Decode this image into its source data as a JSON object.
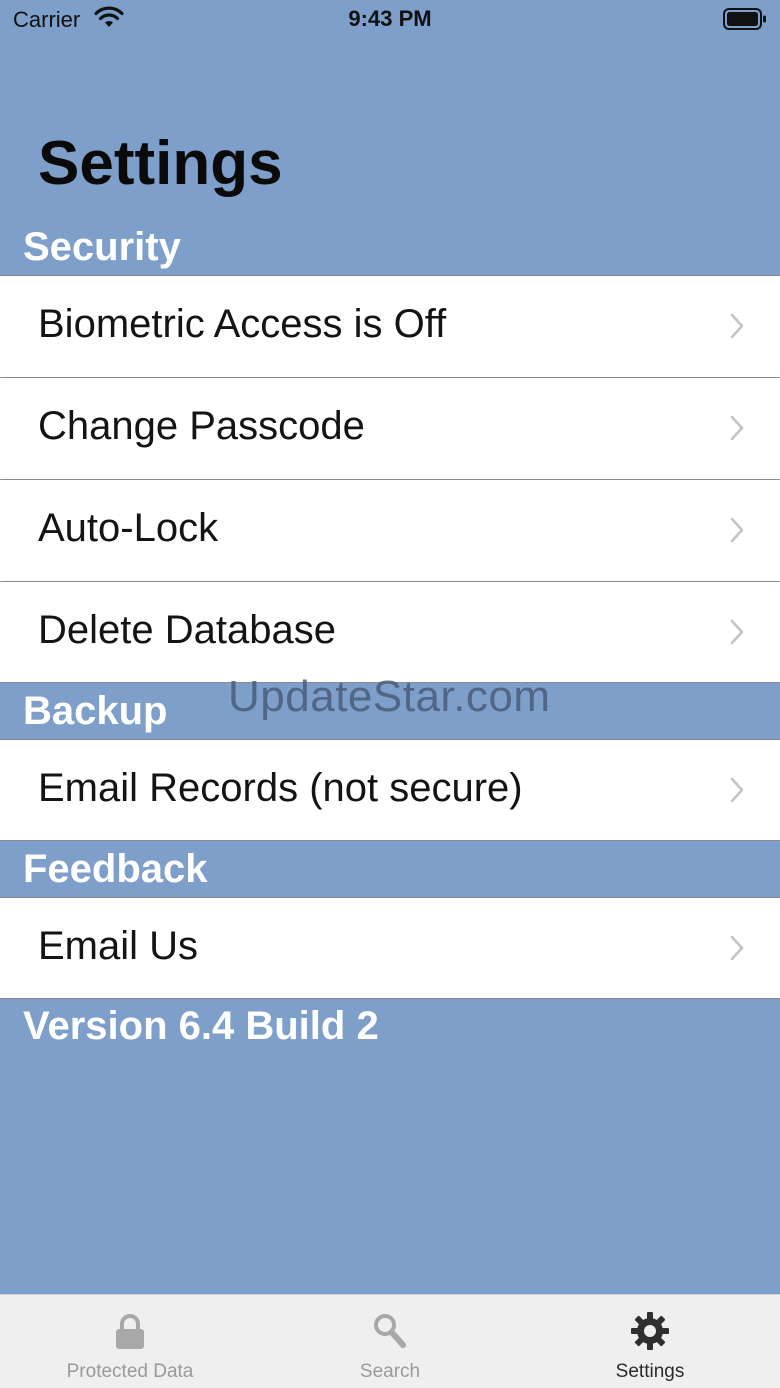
{
  "status_bar": {
    "carrier": "Carrier",
    "time": "9:43 PM",
    "wifi_icon": "wifi-icon",
    "battery_icon": "battery-full-icon"
  },
  "title": "Settings",
  "sections": {
    "security": {
      "header": "Security",
      "rows": [
        "Biometric Access is Off",
        "Change Passcode",
        "Auto-Lock",
        "Delete Database"
      ]
    },
    "backup": {
      "header": "Backup",
      "rows": [
        "Email Records (not secure)"
      ]
    },
    "feedback": {
      "header": "Feedback",
      "rows": [
        "Email Us"
      ]
    }
  },
  "version": "Version 6.4 Build 2",
  "watermark": "UpdateStar.com",
  "tab_bar": {
    "tabs": [
      {
        "label": "Protected Data",
        "icon": "lock-icon",
        "active": false
      },
      {
        "label": "Search",
        "icon": "search-icon",
        "active": false
      },
      {
        "label": "Settings",
        "icon": "gear-icon",
        "active": true
      }
    ]
  },
  "colors": {
    "background": "#7d9fca",
    "row_background": "#ffffff",
    "section_text": "#ffffff",
    "tab_bar": "#efefef",
    "tab_active": "#2b2b2b",
    "tab_inactive": "#9a9a9a"
  }
}
